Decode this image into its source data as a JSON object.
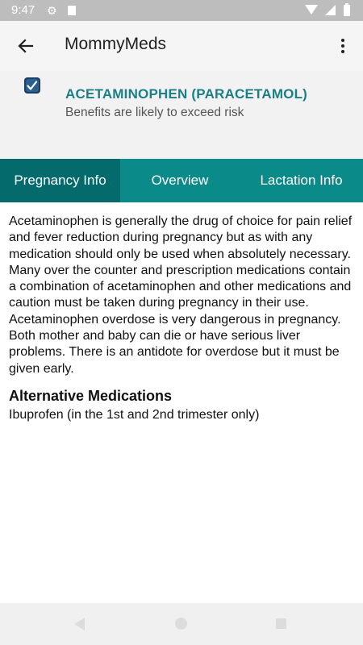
{
  "status_bar": {
    "time": "9:47"
  },
  "app_bar": {
    "title": "MommyMeds"
  },
  "drug": {
    "name": "ACETAMINOPHEN (PARACETAMOL)",
    "risk": "Benefits are likely to exceed risk"
  },
  "tabs": [
    {
      "label": "Pregnancy Info",
      "active": true
    },
    {
      "label": "Overview",
      "active": false
    },
    {
      "label": "Lactation Info",
      "active": false
    }
  ],
  "content": {
    "body": "Acetaminophen is generally the drug of choice for pain relief and fever reduction during pregnancy but as with any medication should only be used when absolutely necessary. Many over the counter and prescription medications contain a combination of acetaminophen and other medications and caution must be taken during pregnancy in their use. Acetaminophen overdose is very dangerous in pregnancy. Both mother and baby can die or have serious liver problems. There is an antidote for overdose but it must be given early.",
    "alternatives_heading": "Alternative Medications",
    "alternatives": "Ibuprofen (in the 1st and 2nd trimester only)"
  },
  "colors": {
    "tab_bar": "#0b8a8a",
    "tab_active": "#046a6c",
    "drug_name": "#1a7f86"
  }
}
